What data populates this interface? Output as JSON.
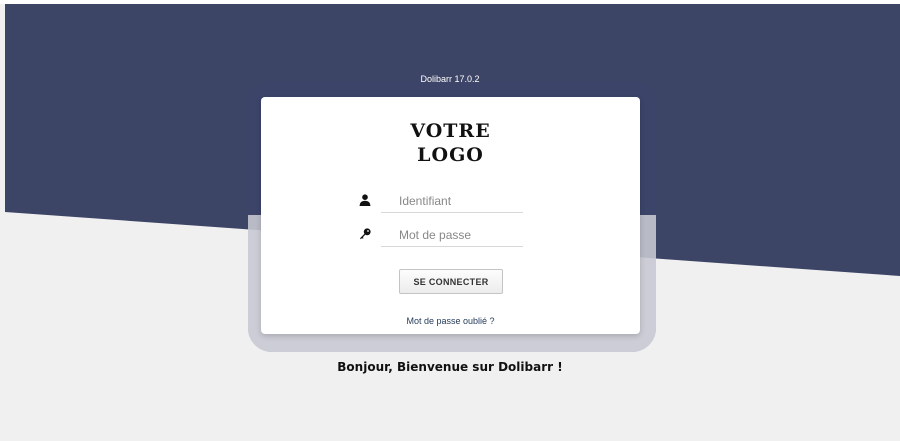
{
  "app": {
    "version_label": "Dolibarr 17.0.2"
  },
  "logo": {
    "line1": "VOTRE",
    "line2": "LOGO"
  },
  "login_form": {
    "username_placeholder": "Identifiant",
    "password_placeholder": "Mot de passe",
    "submit_label": "SE CONNECTER",
    "forgot_password_label": "Mot de passe oublié ?",
    "username_icon": "user-icon",
    "password_icon": "key-icon"
  },
  "welcome_message": "Bonjour, Bienvenue sur Dolibarr !",
  "colors": {
    "banner": "#3d4566",
    "background": "#f0f0f0",
    "card": "#ffffff",
    "link": "#263c5c"
  }
}
